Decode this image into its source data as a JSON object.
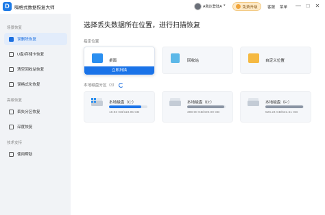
{
  "app": {
    "title": "嗨格式数据恢复大师",
    "logo_letter": "D"
  },
  "topbar": {
    "user_name": "A我达登陆A",
    "vip_label": "免费升级",
    "links": [
      "客服",
      "菜单"
    ],
    "window_controls": [
      "—",
      "□",
      "✕"
    ]
  },
  "sidebar": {
    "sections": [
      {
        "title": "场景恢复",
        "items": [
          {
            "label": "误删除恢复",
            "icon": "trash-file-icon",
            "active": true
          },
          {
            "label": "U盘/存储卡恢复",
            "icon": "usb-icon",
            "active": false
          },
          {
            "label": "清空回收站恢复",
            "icon": "recycle-bin-icon",
            "active": false
          },
          {
            "label": "误格式化恢复",
            "icon": "format-icon",
            "active": false
          }
        ]
      },
      {
        "title": "高级恢复",
        "items": [
          {
            "label": "丢失分区恢复",
            "icon": "partition-icon",
            "active": false
          },
          {
            "label": "深度恢复",
            "icon": "deep-scan-icon",
            "active": false
          }
        ]
      },
      {
        "title": "技术支持",
        "items": [
          {
            "label": "使用帮助",
            "icon": "help-icon",
            "active": false
          }
        ]
      }
    ]
  },
  "main": {
    "title": "选择丢失数据所在位置，进行扫描恢复",
    "locations_label": "指定位置",
    "locations": [
      {
        "name": "桌面",
        "icon": "desktop-icon",
        "color": "#2b8ff0",
        "hover": true
      },
      {
        "name": "回收站",
        "icon": "recycle-bin-icon",
        "color": "#5cb8e8",
        "hover": false
      },
      {
        "name": "自定义位置",
        "icon": "folder-icon",
        "color": "#f5b942",
        "hover": false
      }
    ],
    "scan_button": "立即扫描",
    "partitions_label": "本地磁盘分区（3）",
    "partitions": [
      {
        "name": "本地磁盘（C:）",
        "size": "18.93 GB/118.95 GB",
        "usage": 0.84,
        "color": "#1a73e8",
        "system": true
      },
      {
        "name": "本地磁盘（D:）",
        "size": "389.90 GB/400.00 GB",
        "usage": 0.97,
        "color": "#8a94a3",
        "system": false
      },
      {
        "name": "本地磁盘（F:）",
        "size": "526.24 GB/531.51 GB",
        "usage": 0.99,
        "color": "#8a94a3",
        "system": false
      }
    ]
  }
}
